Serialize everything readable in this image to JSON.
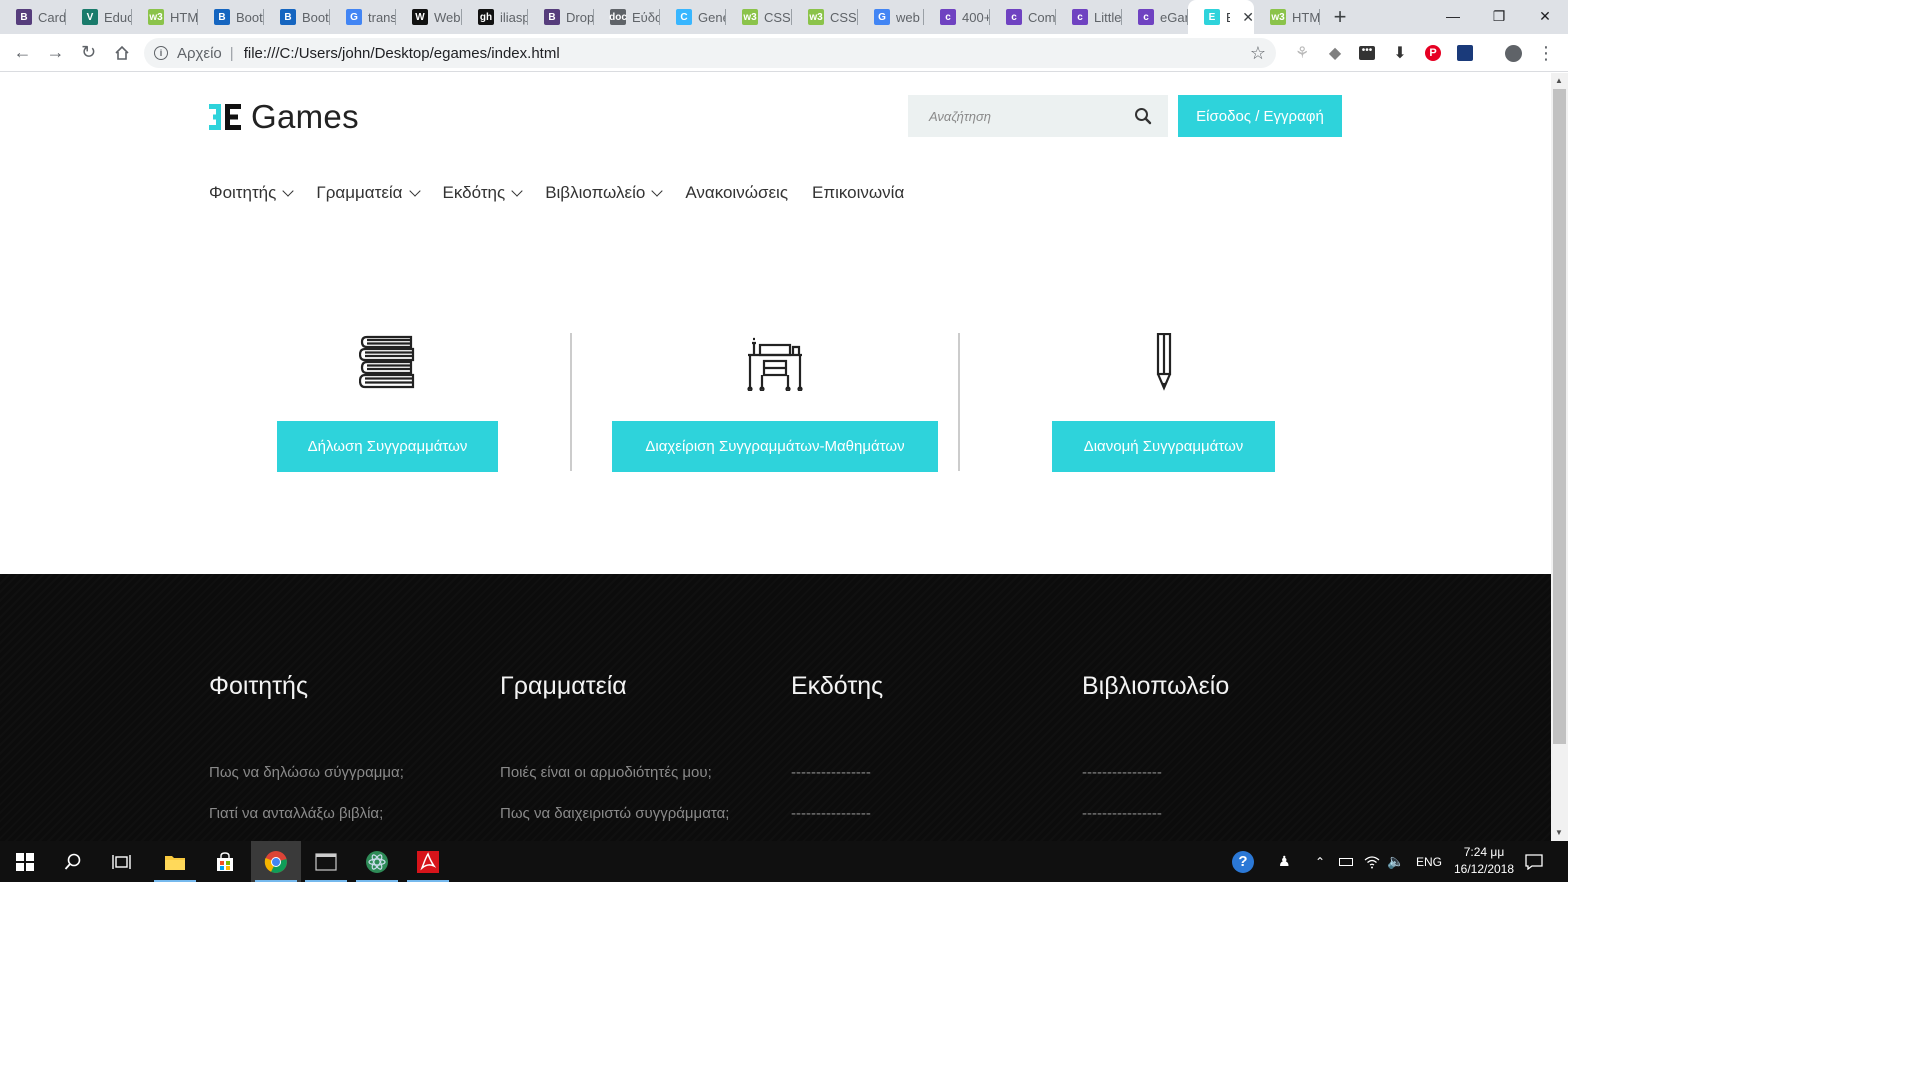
{
  "browser": {
    "tabs": [
      {
        "title": "Card",
        "favicon": "B",
        "color": "#563d7c"
      },
      {
        "title": "Educ",
        "favicon": "V",
        "color": "#1a7b6b"
      },
      {
        "title": "HTM",
        "favicon": "w3",
        "color": "#8bc34a"
      },
      {
        "title": "Boot",
        "favicon": "B",
        "color": "#1565c0"
      },
      {
        "title": "Boot",
        "favicon": "B",
        "color": "#1565c0"
      },
      {
        "title": "trans",
        "favicon": "G",
        "color": "#4285f4"
      },
      {
        "title": "Web",
        "favicon": "W",
        "color": "#111111"
      },
      {
        "title": "iliasp",
        "favicon": "gh",
        "color": "#111111"
      },
      {
        "title": "Drop",
        "favicon": "B",
        "color": "#563d7c"
      },
      {
        "title": "Εύδο",
        "favicon": "doc",
        "color": "#5f6368"
      },
      {
        "title": "Gene",
        "favicon": "C",
        "color": "#38b6ff"
      },
      {
        "title": "CSS",
        "favicon": "w3",
        "color": "#8bc34a"
      },
      {
        "title": "CSS",
        "favicon": "w3",
        "color": "#8bc34a"
      },
      {
        "title": "web",
        "favicon": "G",
        "color": "#4285f4"
      },
      {
        "title": "400+",
        "favicon": "c",
        "color": "#6f42c1"
      },
      {
        "title": "Com",
        "favicon": "c",
        "color": "#6f42c1"
      },
      {
        "title": "Little",
        "favicon": "c",
        "color": "#6f42c1"
      },
      {
        "title": "eGar",
        "favicon": "c",
        "color": "#6f42c1"
      },
      {
        "title": "E",
        "favicon": "E",
        "color": "#2ed3db",
        "active": true
      },
      {
        "title": "HTM",
        "favicon": "w3",
        "color": "#8bc34a"
      }
    ],
    "address": {
      "scheme_label": "Αρχείο",
      "url": "file:///C:/Users/john/Desktop/egames/index.html"
    }
  },
  "site": {
    "logo_text": "Games",
    "search_placeholder": "Αναζήτηση",
    "login_label": "Είσοδος / Εγγραφή",
    "accent_color": "#2ed3db",
    "nav": [
      {
        "label": "Φοιτητής",
        "dropdown": true
      },
      {
        "label": "Γραμματεία",
        "dropdown": true
      },
      {
        "label": "Εκδότης",
        "dropdown": true
      },
      {
        "label": "Βιβλιοπωλείο",
        "dropdown": true
      },
      {
        "label": "Ανακοινώσεις",
        "dropdown": false
      },
      {
        "label": "Επικοινωνία",
        "dropdown": false
      }
    ],
    "features": [
      {
        "icon": "books-icon",
        "button": "Δήλωση Συγγραμμάτων"
      },
      {
        "icon": "desk-icon",
        "button": "Διαχείριση Συγγραμμάτων-Μαθημάτων"
      },
      {
        "icon": "pencil-icon",
        "button": "Διανομή Συγγραμμάτων"
      }
    ],
    "footer": [
      {
        "title": "Φοιτητής",
        "links": [
          "Πως να δηλώσω σύγγραμμα;",
          "Γιατί να ανταλλάξω βιβλία;"
        ]
      },
      {
        "title": "Γραμματεία",
        "links": [
          "Ποιές είναι οι αρμοδιότητές μου;",
          "Πως να δαιχειριστώ συγγράμματα;"
        ]
      },
      {
        "title": "Εκδότης",
        "links": [
          "----------------",
          "----------------"
        ]
      },
      {
        "title": "Βιβλιοπωλείο",
        "links": [
          "----------------",
          "----------------"
        ]
      }
    ]
  },
  "taskbar": {
    "language": "ENG",
    "time": "7:24 μμ",
    "date": "16/12/2018"
  }
}
